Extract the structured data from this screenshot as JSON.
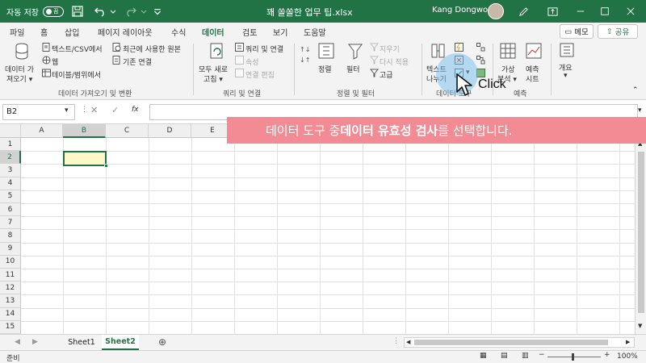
{
  "titlebar": {
    "autosave_label": "자동 저장",
    "autosave_state": "끔",
    "doc_title": "꽤 쏠쏠한 업무 팁.xlsx",
    "user": "Kang Dongwoo"
  },
  "tabs": [
    "파일",
    "홈",
    "삽입",
    "페이지 레이아웃",
    "수식",
    "데이터",
    "검토",
    "보기",
    "도움말"
  ],
  "active_tab": "데이터",
  "share": {
    "memo": "메모",
    "share": "공유"
  },
  "ribbon": {
    "get_data": {
      "line1": "데이터 가",
      "line2": "져오기 ▾"
    },
    "text_csv": "텍스트/CSV에서",
    "web": "웹",
    "table_range": "테이블/범위에서",
    "recent_sources": "최근에 사용한 원본",
    "existing_conn": "기존 연결",
    "group_get": "데이터 가져오기 및 변환",
    "refresh_all": {
      "line1": "모두 새로",
      "line2": "고침 ▾"
    },
    "queries_conn": "쿼리 및 연결",
    "properties": "속성",
    "edit_links": "연결 편집",
    "group_queries": "쿼리 및 연결",
    "sort": "정렬",
    "filter": "필터",
    "clear": "지우기",
    "reapply": "다시 적용",
    "advanced": "고급",
    "group_sort": "정렬 및 필터",
    "text_to_col": {
      "line1": "텍스트",
      "line2": "나누기"
    },
    "group_tools": "데이터 도구",
    "whatif": {
      "line1": "가상",
      "line2": "분석 ▾"
    },
    "forecast": {
      "line1": "예측",
      "line2": "시트"
    },
    "group_forecast": "예측",
    "outline": {
      "line1": "개요",
      "line2": "▾"
    }
  },
  "formula_bar": {
    "name_box": "B2",
    "fx": "fx"
  },
  "columns": [
    "A",
    "B",
    "C",
    "D",
    "E"
  ],
  "selected_column": "B",
  "rows": [
    "1",
    "2",
    "3",
    "4",
    "5",
    "6",
    "7",
    "8",
    "9",
    "10",
    "11",
    "12",
    "13",
    "14",
    "15"
  ],
  "selected_row": "2",
  "banner": {
    "pre": "데이터 도구 중 ",
    "bold": "데이터 유효성 검사",
    "post": "를 선택합니다."
  },
  "click_label": "Click",
  "sheets": [
    "Sheet1",
    "Sheet2"
  ],
  "active_sheet": "Sheet2",
  "status": {
    "ready": "준비",
    "zoom": "100%"
  },
  "colors": {
    "excel_green": "#217346",
    "banner": "#f28b93",
    "selected_fill": "#fff7c8"
  }
}
